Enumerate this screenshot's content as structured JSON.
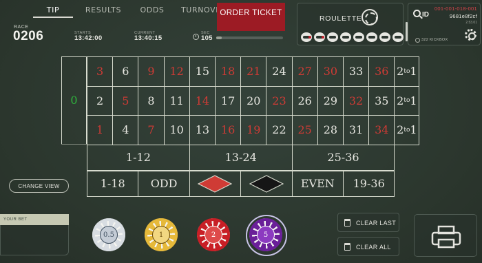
{
  "tabs": [
    "TIP",
    "RESULTS",
    "ODDS",
    "TURNOVER"
  ],
  "order_ticket": "ORDER TICKET",
  "race": {
    "label": "RACE",
    "value": "0206"
  },
  "starts": {
    "label": "STARTS",
    "value": "13:42:00"
  },
  "current": {
    "label": "CURRENT",
    "value": "13:40:15"
  },
  "sec": {
    "label": "SEC",
    "value": "105",
    "progress": 0.08
  },
  "game": {
    "title": "ROULETTE",
    "icon": "roulette-wheel-icon",
    "game_icons": [
      "greyhound-icon",
      "horse-icon",
      "horse-icon",
      "horse-icon",
      "greyhound-icon",
      "car-racing-icon",
      "roulette-wheel-icon",
      "rifle-icon"
    ]
  },
  "id_panel": {
    "label": "ID",
    "code_red": "001-001-018-001",
    "code": "9681e8f2cf",
    "version": "2.53.01",
    "kickbox": "322  KICKBOX"
  },
  "table": {
    "zero": "0",
    "rows": [
      [
        {
          "n": "3",
          "c": "red"
        },
        {
          "n": "6",
          "c": "black"
        },
        {
          "n": "9",
          "c": "red"
        },
        {
          "n": "12",
          "c": "red"
        },
        {
          "n": "15",
          "c": "black"
        },
        {
          "n": "18",
          "c": "red"
        },
        {
          "n": "21",
          "c": "red"
        },
        {
          "n": "24",
          "c": "black"
        },
        {
          "n": "27",
          "c": "red"
        },
        {
          "n": "30",
          "c": "red"
        },
        {
          "n": "33",
          "c": "black"
        },
        {
          "n": "36",
          "c": "red"
        }
      ],
      [
        {
          "n": "2",
          "c": "black"
        },
        {
          "n": "5",
          "c": "red"
        },
        {
          "n": "8",
          "c": "black"
        },
        {
          "n": "11",
          "c": "black"
        },
        {
          "n": "14",
          "c": "red"
        },
        {
          "n": "17",
          "c": "black"
        },
        {
          "n": "20",
          "c": "black"
        },
        {
          "n": "23",
          "c": "red"
        },
        {
          "n": "26",
          "c": "black"
        },
        {
          "n": "29",
          "c": "black"
        },
        {
          "n": "32",
          "c": "red"
        },
        {
          "n": "35",
          "c": "black"
        }
      ],
      [
        {
          "n": "1",
          "c": "red"
        },
        {
          "n": "4",
          "c": "black"
        },
        {
          "n": "7",
          "c": "red"
        },
        {
          "n": "10",
          "c": "black"
        },
        {
          "n": "13",
          "c": "black"
        },
        {
          "n": "16",
          "c": "red"
        },
        {
          "n": "19",
          "c": "red"
        },
        {
          "n": "22",
          "c": "black"
        },
        {
          "n": "25",
          "c": "red"
        },
        {
          "n": "28",
          "c": "black"
        },
        {
          "n": "31",
          "c": "black"
        },
        {
          "n": "34",
          "c": "red"
        }
      ]
    ],
    "column_bet": {
      "num": "2",
      "to": "to",
      "last": "1"
    },
    "dozens": [
      "1-12",
      "13-24",
      "25-36"
    ],
    "outside": [
      "1-18",
      "ODD",
      "",
      "",
      "EVEN",
      "19-36"
    ]
  },
  "change_view": "CHANGE VIEW",
  "your_bet": "YOUR BET",
  "chips": [
    {
      "value": "0.5",
      "color": "#d8dde2",
      "inner": "#c4ccd6",
      "text": "#405060"
    },
    {
      "value": "1",
      "color": "#e6b93a",
      "inner": "#f2d781",
      "text": "#6a4a08"
    },
    {
      "value": "2",
      "color": "#c81f26",
      "inner": "#de4a4a",
      "text": "#ffffff"
    },
    {
      "value": "5",
      "color": "#6a1f99",
      "inner": "#8c3ac0",
      "text": "#ffffff"
    }
  ],
  "clear_last": "CLEAR LAST",
  "clear_all": "CLEAR ALL",
  "colors": {
    "red": "#cf3b35",
    "black": "#161616",
    "felt": "#2f3b30"
  }
}
